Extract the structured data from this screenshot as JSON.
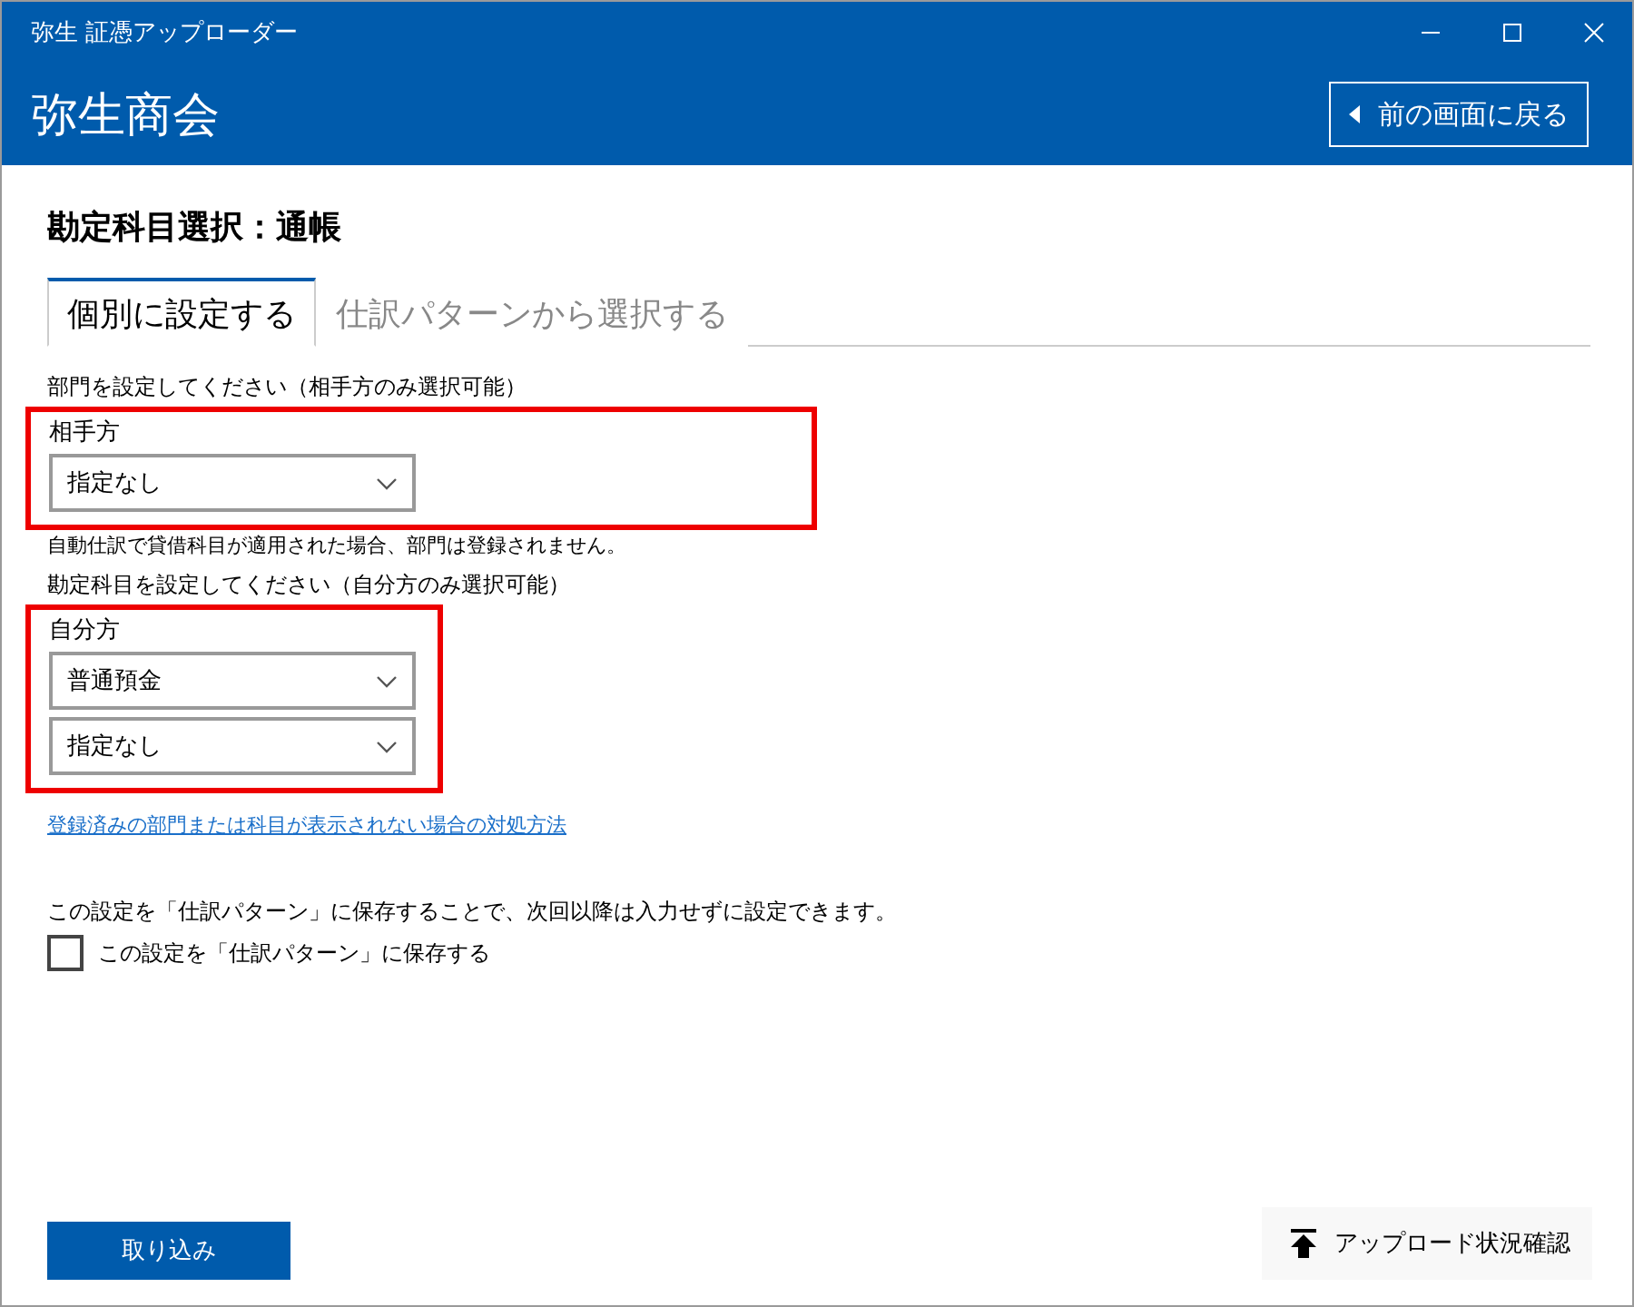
{
  "window": {
    "title": "弥生 証憑アップローダー"
  },
  "header": {
    "company": "弥生商会",
    "back_button": "前の画面に戻る"
  },
  "heading": "勘定科目選択：通帳",
  "tabs": [
    {
      "label": "個別に設定する",
      "selected": true
    },
    {
      "label": "仕訳パターンから選択する",
      "selected": false
    }
  ],
  "sections": [
    {
      "instruction": "部門を設定してください（相手方のみ選択可能）",
      "group_label": "相手方",
      "highlighted": true,
      "dropdowns": [
        "指定なし"
      ],
      "note": "自動仕訳で貸借科目が適用された場合、部門は登録されません。"
    },
    {
      "instruction": "勘定科目を設定してください（自分方のみ選択可能）",
      "group_label": "自分方",
      "highlighted": true,
      "dropdowns": [
        "普通預金",
        "指定なし"
      ]
    }
  ],
  "help_link": "登録済みの部門または科目が表示されない場合の対処方法",
  "save_info": "この設定を「仕訳パターン」に保存することで、次回以降は入力せずに設定できます。",
  "save_checkbox": {
    "label": "この設定を「仕訳パターン」に保存する",
    "checked": false
  },
  "import_button": "取り込み",
  "status_button": "アップロード状況確認"
}
